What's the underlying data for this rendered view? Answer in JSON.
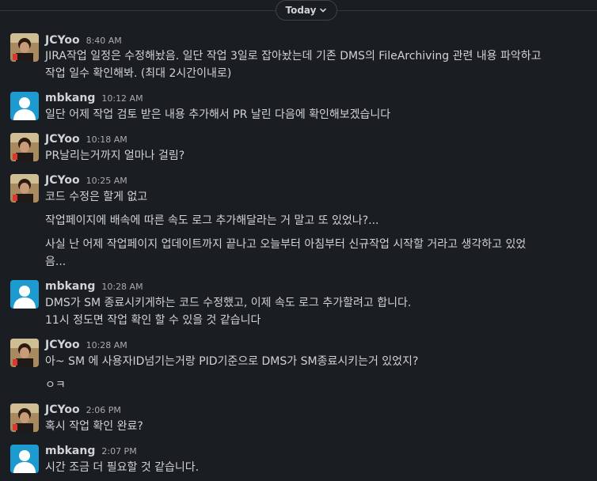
{
  "day_divider": {
    "label": "Today"
  },
  "messages": [
    {
      "sender": "JCYoo",
      "time": "8:40 AM",
      "lines": [
        "JIRA작업 일정은 수정해놨음. 일단 작업 3일로 잡아놨는데 기존 DMS의 FileArchiving 관련 내용 파악하고",
        "작업 일수 확인해봐. (최대 2시간이내로)"
      ]
    },
    {
      "sender": "mbkang",
      "time": "10:12 AM",
      "lines": [
        "일단 어제 작업 검토 받은 내용 추가해서 PR 날린 다음에 확인해보겠습니다"
      ]
    },
    {
      "sender": "JCYoo",
      "time": "10:18 AM",
      "lines": [
        "PR날리는거까지 얼마나 걸림?"
      ]
    },
    {
      "sender": "JCYoo",
      "time": "10:25 AM",
      "lines": [
        "코드 수정은 할게 없고",
        "작업페이지에 배속에 따른 속도 로그 추가해달라는 거 말고 또 있었나?...",
        "사실 난 어제 작업페이지 업데이트까지 끝나고 오늘부터 아침부터 신규작업 시작할 거라고 생각하고 있었",
        "음..."
      ]
    },
    {
      "sender": "mbkang",
      "time": "10:28 AM",
      "lines": [
        "DMS가 SM 종료시키게하는 코드 수정했고, 이제 속도 로그 추가할려고 합니다.",
        "11시 정도면 작업 확인 할 수 있을 것 같습니다"
      ]
    },
    {
      "sender": "JCYoo",
      "time": "10:28 AM",
      "lines": [
        "아~ SM 에 사용자ID넘기는거랑 PID기준으로 DMS가 SM종료시키는거 있었지?",
        "ㅇㅋ"
      ]
    },
    {
      "sender": "JCYoo",
      "time": "2:06 PM",
      "lines": [
        "혹시 작업 확인 완료?"
      ]
    },
    {
      "sender": "mbkang",
      "time": "2:07 PM",
      "lines": [
        "시간 조금 더 필요할 것 같습니다."
      ]
    }
  ],
  "colors": {
    "background": "#1a1d21",
    "text": "#d1d2d3",
    "timestamp": "#ababad",
    "default_avatar": "#1d9bd1"
  },
  "icons": {
    "day_divider": "chevron-down-icon",
    "photo_avatar": "avatar-photo",
    "default_avatar": "default-user-avatar-icon"
  }
}
